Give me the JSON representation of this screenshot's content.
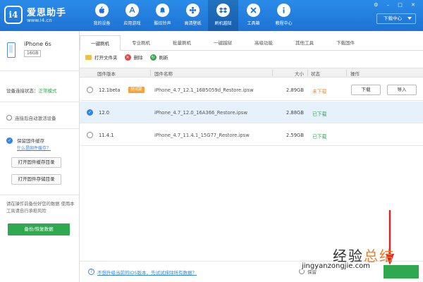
{
  "app": {
    "name": "爱思助手",
    "url": "www.i4.cn",
    "logo_mark": "i4"
  },
  "nav": [
    {
      "label": "我的设备",
      "icon": "apple-icon"
    },
    {
      "label": "应用游戏",
      "icon": "app-store-icon"
    },
    {
      "label": "酷炫铃声",
      "icon": "bell-icon"
    },
    {
      "label": "高清壁纸",
      "icon": "flower-icon"
    },
    {
      "label": "刷机越狱",
      "icon": "dropbox-icon",
      "active": true
    },
    {
      "label": "工具箱",
      "icon": "toolbox-icon"
    },
    {
      "label": "教程中心",
      "icon": "info-icon"
    }
  ],
  "download_center": "下载中心",
  "window_controls": "⚙ – □ ✕",
  "sidebar": {
    "device_name": "iPhone 6s",
    "storage": "16GB",
    "connection_label": "设备连接状态：",
    "connection_value": "正常模式",
    "auto_activate": "连接后自动激活设备",
    "keep_firmware": "保留固件缓存",
    "keep_firmware_link": "什么是固件缓存？",
    "open_cache_dir": "打开固件缓存目录",
    "open_storage_dir": "打开固件存储目录",
    "note": "请在操作前备份好您的数据 使用本工具请自行承担风险",
    "backup_button": "备份/恢复数据"
  },
  "tabs": [
    "一键刷机",
    "专业刷机",
    "批量刷机",
    "一键越狱",
    "高级功能",
    "其他工具",
    "下载固件"
  ],
  "toolbar": {
    "open_folder": "打开文件夹",
    "delete": "删除",
    "refresh": "刷新"
  },
  "table": {
    "headers": {
      "version": "固件版本",
      "name": "固件名称",
      "size": "大小",
      "status": "状态",
      "action": "操作"
    },
    "rows": [
      {
        "version": "12.1beta",
        "tag": "测试版",
        "file": "iPhone_4.7_12.1_16B5059d_Restore.ipsw",
        "size": "2.89GB",
        "status": "未下载",
        "status_color": "#f08a24",
        "selected": false,
        "download": "下载",
        "import": "导入"
      },
      {
        "version": "12.0",
        "tag": "",
        "file": "iPhone_4.7_12.0_16A366_Restore.ipsw",
        "size": "2.88GB",
        "status": "已下载",
        "status_color": "#2ca24a",
        "selected": true
      },
      {
        "version": "11.4.1",
        "tag": "",
        "file": "iPhone_4.7_11.4.1_15G77_Restore.ipsw",
        "size": "2.59GB",
        "status": "已下载",
        "status_color": "#2ca24a",
        "selected": false
      }
    ]
  },
  "bottom": {
    "link": "不想升级当前的iOS版本，先试试抹除所有数据？",
    "keep_data": "保留"
  },
  "watermark": {
    "cn_a": "经验",
    "cn_b": "总结",
    "url": "jingyanzongjie.com"
  },
  "colors": {
    "header": "#1d73d4",
    "accent_green": "#2fa84f",
    "link_blue": "#2f85e8",
    "arrow_red": "#d8232a"
  }
}
